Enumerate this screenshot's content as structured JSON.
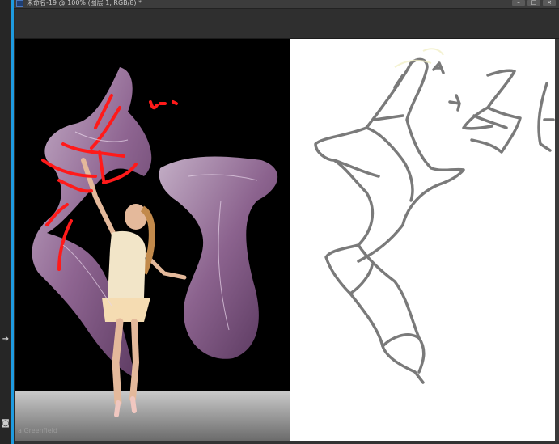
{
  "window": {
    "title": "未命名-19 @ 100% (图层 1, RGB/8) *",
    "app_icon": "ps-icon",
    "controls": [
      "minimize-icon",
      "maximize-icon",
      "close-icon"
    ]
  },
  "left_rail": {
    "icons": [
      "arrow-right-icon",
      "camera-icon"
    ]
  },
  "canvas": {
    "photo_credit": "a Greenfield",
    "photo_background": "#000000",
    "fabric_color": "#9b6e9e",
    "annotation_color": "#ff1a1a",
    "sketch_background": "#ffffff",
    "sketch_stroke": "#7a7a7a"
  },
  "colors": {
    "accent": "#1e9be0",
    "chrome_dark": "#262626",
    "titlebar": "#3c3c3c"
  }
}
